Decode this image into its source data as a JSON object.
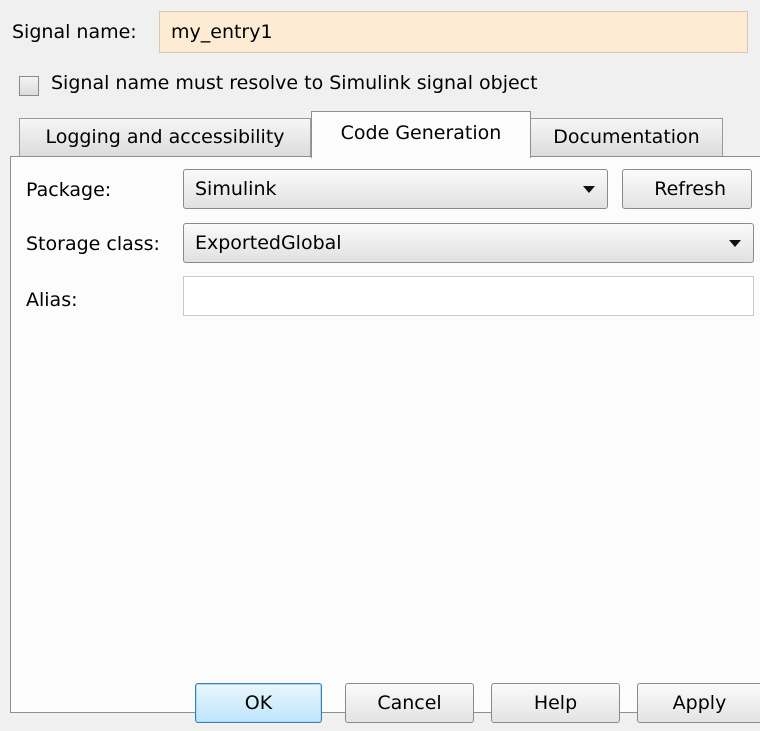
{
  "signal": {
    "label": "Signal name:",
    "value": "my_entry1"
  },
  "resolve": {
    "checked": false,
    "label": "Signal name must resolve to Simulink signal object"
  },
  "tabs": [
    {
      "label": "Logging and accessibility",
      "active": false
    },
    {
      "label": "Code Generation",
      "active": true
    },
    {
      "label": "Documentation",
      "active": false
    }
  ],
  "code_generation": {
    "package_label": "Package:",
    "package_value": "Simulink",
    "refresh_label": "Refresh",
    "storage_label": "Storage class:",
    "storage_value": "ExportedGlobal",
    "alias_label": "Alias:",
    "alias_value": ""
  },
  "buttons": {
    "ok": "OK",
    "cancel": "Cancel",
    "help": "Help",
    "apply": "Apply"
  },
  "colors": {
    "signal_field_bg": "#fdebd4",
    "ok_accent": "#3c7fb1"
  }
}
